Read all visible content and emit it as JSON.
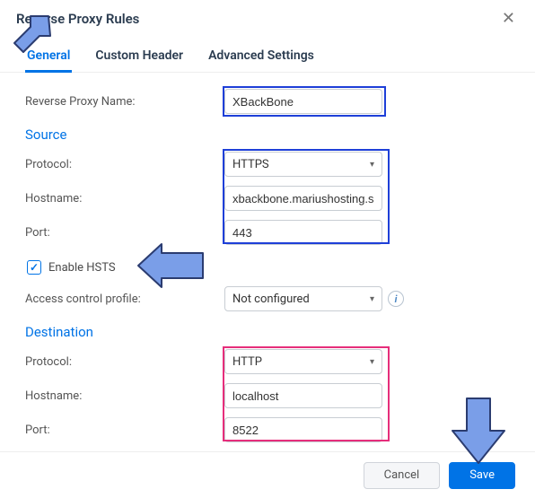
{
  "dialog": {
    "title": "Reverse Proxy Rules"
  },
  "tabs": {
    "general": "General",
    "custom_header": "Custom Header",
    "advanced": "Advanced Settings"
  },
  "fields": {
    "name_label": "Reverse Proxy Name:",
    "name_value": "XBackBone",
    "source_heading": "Source",
    "src_protocol_label": "Protocol:",
    "src_protocol_value": "HTTPS",
    "src_hostname_label": "Hostname:",
    "src_hostname_value": "xbackbone.mariushosting.s",
    "src_port_label": "Port:",
    "src_port_value": "443",
    "enable_hsts_label": "Enable HSTS",
    "acp_label": "Access control profile:",
    "acp_value": "Not configured",
    "dest_heading": "Destination",
    "dst_protocol_label": "Protocol:",
    "dst_protocol_value": "HTTP",
    "dst_hostname_label": "Hostname:",
    "dst_hostname_value": "localhost",
    "dst_port_label": "Port:",
    "dst_port_value": "8522"
  },
  "footer": {
    "cancel": "Cancel",
    "save": "Save"
  },
  "icons": {
    "close": "✕",
    "check": "✓",
    "caret": "▾",
    "info": "i"
  }
}
